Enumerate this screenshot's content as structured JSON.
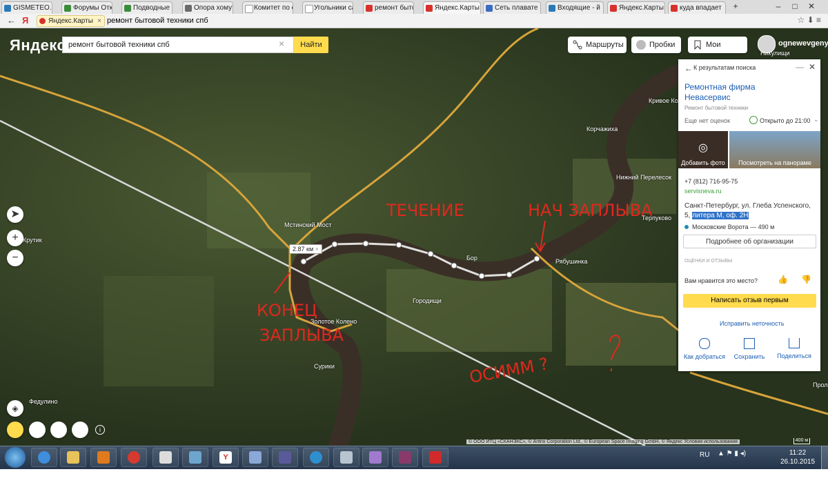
{
  "browser": {
    "tabs": [
      {
        "label": "GISMETEO.RU",
        "color": "#2a7ab8"
      },
      {
        "label": "Форумы Отк",
        "color": "#3b8c3a"
      },
      {
        "label": "Подводные",
        "color": "#3b8c3a"
      },
      {
        "label": "Опора хомут",
        "color": "#6a6a6a"
      },
      {
        "label": "Комитет по с",
        "color": "#e8e8e8"
      },
      {
        "label": "Угольники са",
        "color": "#e8e8e8"
      },
      {
        "label": "ремонт быто",
        "color": "#d8312c"
      },
      {
        "label": "Яндекс.Карты",
        "color": "#d8312c"
      },
      {
        "label": "Сеть плавате",
        "color": "#3b6cc0"
      },
      {
        "label": "Входящие - й",
        "color": "#2a7ab8"
      },
      {
        "label": "Яндекс.Карты",
        "color": "#d8312c"
      },
      {
        "label": "куда впадает",
        "color": "#d8312c"
      }
    ],
    "address_pill": "Яндекс.Карты",
    "address_query": "ремонт бытовой техники спб"
  },
  "header": {
    "logo": "Яндекс",
    "search_value": "ремонт бытовой техники спб",
    "search_button": "Найти",
    "routes_button": "Маршруты",
    "traffic_button": "Пробки",
    "myplaces_button": "Мои места",
    "username": "ognewevgeny"
  },
  "card": {
    "back_label": "К результатам поиска",
    "title_line1": "Ремонтная фирма",
    "title_line2": "Невасервис",
    "category": "Ремонт бытовой техники",
    "no_ratings": "Еще нет оценок",
    "hours": "Открыто до 21:00",
    "add_photo": "Добавить фото",
    "view_panorama": "Посмотреть на панораме",
    "phone": "+7 (812) 716-95-75",
    "website": "servisneva.ru",
    "address_line1": "Санкт-Петербург, ул. Глеба Успенского,",
    "address_line2_prefix": "5, ",
    "address_line2_highlight": "литера М, оф. 2Н",
    "metro": "Московские Ворота — 490 м",
    "more_button": "Подробнее об организации",
    "reviews_header": "ОЦЕНКИ И ОТЗЫВЫ",
    "like_question": "Вам нравится это место?",
    "review_button": "Написать отзыв первым",
    "fix_link": "Исправить неточность",
    "actions": [
      "Как добраться",
      "Сохранить",
      "Поделиться"
    ]
  },
  "map": {
    "ruler_label": "2.87 км",
    "attribution": "© ООО ИТЦ «СКАНЭКС», © Antrix Corporation Ltd., © European Space Imaging GmbH, © Яндекс Условия использования",
    "scale": "400 м",
    "places": [
      {
        "name": "Мстинский Мост"
      },
      {
        "name": "Бор"
      },
      {
        "name": "Городищи"
      },
      {
        "name": "Золотое Колено"
      },
      {
        "name": "Сурики"
      },
      {
        "name": "Рябушинка"
      },
      {
        "name": "Корчажиха"
      },
      {
        "name": "Нижний Перелесок"
      },
      {
        "name": "Терпуково"
      },
      {
        "name": "Кривое Колено"
      },
      {
        "name": "Крутик"
      },
      {
        "name": "Федулино"
      },
      {
        "name": "Никулищи"
      },
      {
        "name": "Пролет"
      }
    ],
    "annotations": {
      "current": "ТЕЧЕНИЕ",
      "start": "НАЧ ЗАПЛЫВА",
      "end_line1": "КОНЕЦ",
      "end_line2": "ЗАПЛЫВА",
      "question": "ОСИММ ?"
    }
  },
  "taskbar": {
    "lang": "RU",
    "time": "11:22",
    "date": "26.10.2015"
  }
}
